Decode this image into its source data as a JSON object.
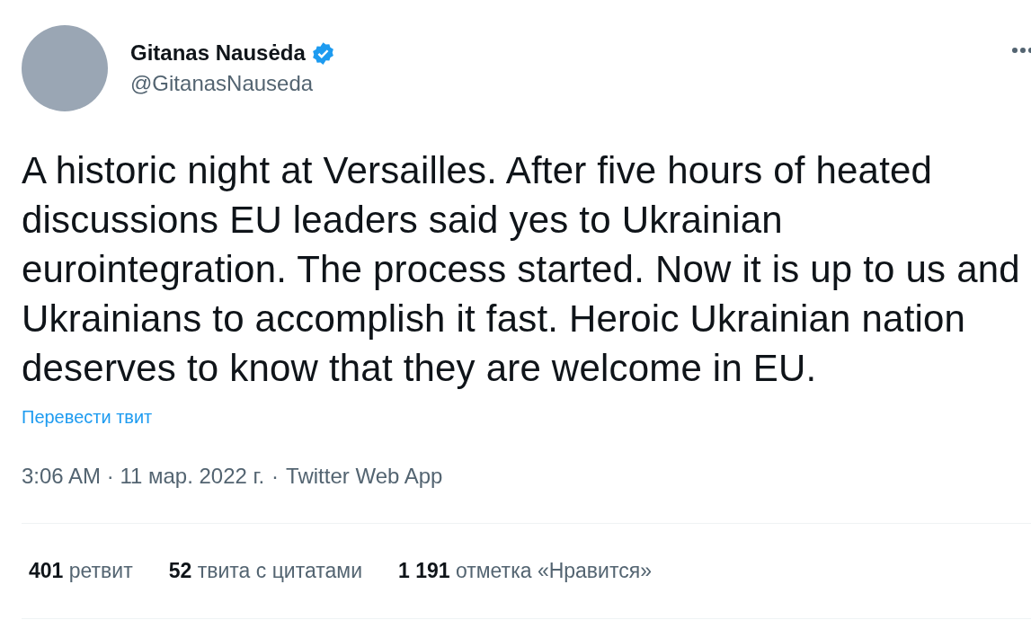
{
  "author": {
    "name": "Gitanas Nausėda",
    "verified": true,
    "handle": "@GitanasNauseda"
  },
  "tweet": {
    "text": "A historic night at Versailles. After five hours of heated discussions EU leaders said yes to Ukrainian eurointegration. The process started. Now it is up to us and Ukrainians to accomplish it fast. Heroic Ukrainian nation deserves to know that they are welcome in EU.",
    "translate_link": "Перевести твит",
    "time": "3:06 AM",
    "date": "11 мар. 2022 г.",
    "separator": "·",
    "source": "Twitter Web App"
  },
  "stats": [
    {
      "count": "401",
      "label": "ретвит"
    },
    {
      "count": "52",
      "label": "твита с цитатами"
    },
    {
      "count": "1 191",
      "label": "отметка «Нравится»"
    }
  ]
}
